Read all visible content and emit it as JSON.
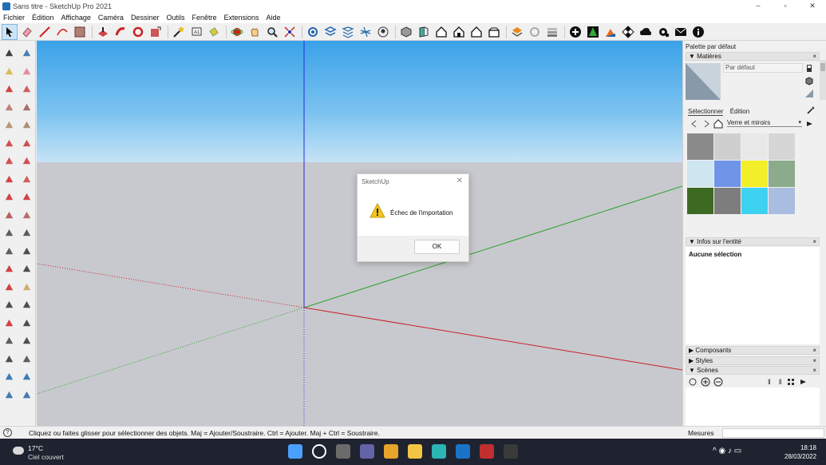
{
  "window": {
    "title": "Sans titre - SketchUp Pro 2021",
    "min": "–",
    "max": "▫",
    "close": "✕"
  },
  "menu": [
    "Fichier",
    "Édition",
    "Affichage",
    "Caméra",
    "Dessiner",
    "Outils",
    "Fenêtre",
    "Extensions",
    "Aide"
  ],
  "toolbar_icons": [
    "select-icon",
    "eraser-icon",
    "line-icon",
    "arc-icon",
    "rectangle-icon",
    "push-pull-icon",
    "follow-me-icon",
    "rotate-icon",
    "scale-icon",
    "tape-measure-icon",
    "text-icon",
    "paint-bucket-icon",
    "orbit-icon",
    "pan-icon",
    "zoom-icon",
    "zoom-extents-icon",
    "warehouse-icon",
    "extension-warehouse-icon",
    "layout-icon",
    "previous-view-icon",
    "section-plane-icon",
    "iso-view-icon",
    "top-view-icon",
    "front-view-icon",
    "right-view-icon",
    "back-view-icon",
    "left-view-icon",
    "shadows-icon",
    "sandbox-icon",
    "add-location-icon",
    "terrain-icon",
    "photo-texture-icon",
    "profile-icon",
    "cloud-icon",
    "settings-icon",
    "mail-icon",
    "info-icon"
  ],
  "dialog": {
    "title": "SketchUp",
    "close": "✕",
    "message": "Échec de l'importation",
    "ok": "OK"
  },
  "right_panel": {
    "tray_title": "Palette par défaut",
    "materials_header": "Matières",
    "material_name": "Par défaut",
    "tab_select": "Sélectionner",
    "tab_edit": "Édition",
    "library": "Verre et miroirs",
    "entity_header": "Infos sur l'entité",
    "entity_empty": "Aucune sélection",
    "components_header": "Composants",
    "styles_header": "Styles",
    "scenes_header": "Scènes",
    "close_x": "×",
    "expand": "▶",
    "collapse": "▼",
    "scene_sep1": "‖",
    "scene_sep2": "‖"
  },
  "swatch_colors": [
    "#8a8a8a",
    "#cfcfcf",
    "#e8e8e8",
    "#d6d6d6",
    "#cfe6f0",
    "#6f94e8",
    "#f2ef2a",
    "#8bab8b",
    "#3c6a22",
    "#7d7d7d",
    "#3dd2ef",
    "#a9bde0"
  ],
  "status": {
    "icon": "?",
    "hint": "Cliquez ou faites glisser pour sélectionner des objets. Maj = Ajouter/Soustraire. Ctrl = Ajouter. Maj + Ctrl = Soustraire.",
    "measure_label": "Mesures"
  },
  "taskbar": {
    "temp": "17°C",
    "condition": "Ciel couvert",
    "tray": "^ ◉ ♪ ▭",
    "time": "18:18",
    "date": "28/03/2022",
    "app_colors": [
      "#4aa0ff",
      "#ffffff",
      "#6b6b6b",
      "#6264a7",
      "#e8a32b",
      "#f4c542",
      "#2bb5b5",
      "#1a73c7",
      "#c22f2f",
      "#3a3a3a"
    ]
  },
  "colors": {
    "sky_top": "#3aa2e8",
    "ground": "#c8c9ce",
    "axis_red": "#c8202a",
    "axis_green": "#2aa02a",
    "axis_blue": "#2a2ad8"
  }
}
